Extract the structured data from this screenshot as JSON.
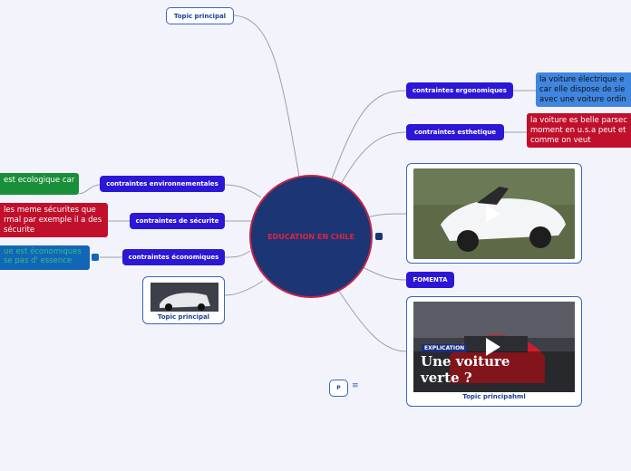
{
  "center": {
    "label": "EDUCATION EN CHILE"
  },
  "right": {
    "ergonomiques": {
      "label": "contraintes ergonomiques",
      "note": [
        "la voiture  électrique e",
        "car elle dispose de sie",
        "avec une voiture ordin"
      ]
    },
    "esthetique": {
      "label": "contraintes esthetique",
      "note": [
        "la voiture es belle parsec",
        "moment en u.s.a peut et",
        "comme on veut"
      ]
    },
    "fomenta": {
      "label": "FOMENTA"
    },
    "video_card": {
      "caption": "Topic principahml",
      "explication": "EXPLICATION",
      "headline": [
        "Une voiture",
        "verte ?"
      ]
    }
  },
  "left": {
    "environnementales": {
      "label": "contraintes environnementales",
      "note": [
        "est ecologique car"
      ]
    },
    "securite": {
      "label": "contraintes de sécurite",
      "note": [
        "les meme sécurites que",
        "rmal par exemple il a des",
        "sécurite"
      ]
    },
    "economiques": {
      "label": "contraintes économiques",
      "note": [
        "ue est économiques",
        "se pas d' essence"
      ]
    },
    "image_topic": {
      "caption": "Topic principal"
    }
  },
  "top_topic": {
    "label": "Topic principal"
  },
  "toolbar": {
    "p_label": "P",
    "menu_icon": "≡"
  },
  "colors": {
    "pill": "#2d17d6",
    "center_fill": "#1b3575",
    "center_text": "#e02342",
    "note_blue": "#3f86e0",
    "note_red": "#c0102c",
    "note_green": "#1a8f3a",
    "note_blue2": "#1266b8"
  }
}
